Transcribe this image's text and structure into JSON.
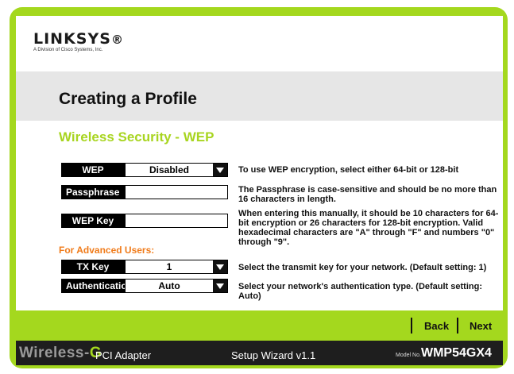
{
  "brand": {
    "logo_text": "LINKSYS",
    "logo_mark": "®",
    "division": "A Division of Cisco Systems, Inc."
  },
  "page": {
    "title": "Creating a Profile",
    "section_title": "Wireless Security - WEP"
  },
  "form": {
    "wep": {
      "label": "WEP",
      "value": "Disabled"
    },
    "passphrase": {
      "label": "Passphrase",
      "value": ""
    },
    "wep_key": {
      "label": "WEP Key",
      "value": ""
    },
    "advanced_heading": "For Advanced Users:",
    "tx_key": {
      "label": "TX Key",
      "value": "1"
    },
    "authentication": {
      "label": "Authentication",
      "value": "Auto"
    }
  },
  "help": {
    "wep": "To use WEP encryption, select either 64-bit or 128-bit",
    "passphrase": "The Passphrase is case-sensitive and should be no more than 16 characters in length.",
    "wep_key": "When entering this manually, it should be 10 characters for 64-bit encryption or 26 characters for 128-bit encryption. Valid hexadecimal characters are \"A\" through \"F\" and numbers \"0\" through \"9\".",
    "tx_key": "Select the transmit key for your network. (Default setting: 1)",
    "authentication": "Select your network's authentication type. (Default setting: Auto)"
  },
  "nav": {
    "back": "Back",
    "next": "Next"
  },
  "footer": {
    "brand_prefix": "Wireless-",
    "brand_g": "G",
    "product": "PCI Adapter",
    "wizard": "Setup Wizard  v1.1",
    "model_label": "Model No.",
    "model": "WMP54GX4"
  },
  "colors": {
    "accent": "#a4d81e",
    "section_title": "#a8d520",
    "advanced": "#f07b1a"
  }
}
